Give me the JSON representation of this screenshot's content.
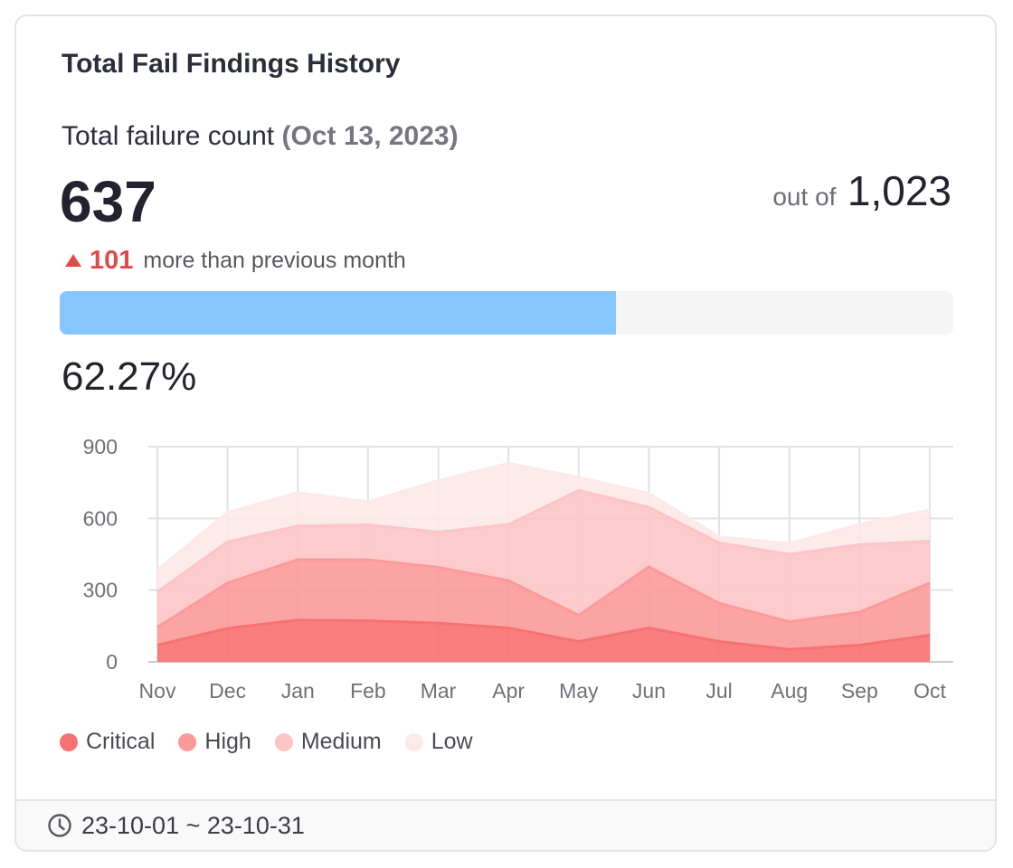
{
  "card": {
    "title": "Total Fail Findings History",
    "subtitle": "Total failure count",
    "date": "(Oct 13, 2023)",
    "count": "637",
    "out_of_label": "out of",
    "total": "1,023",
    "delta_value": "101",
    "delta_text": "more than previous month",
    "progress_fraction": 0.6227,
    "percent_text": "62.27%",
    "footer_range": "23-10-01 ~ 23-10-31"
  },
  "colors": {
    "critical": "#f87171",
    "high": "#fc9a9a",
    "medium": "#fdc5c5",
    "low": "#fde9e9",
    "accent_red": "#e24a4a",
    "progress": "#86c6fb"
  },
  "chart_data": {
    "type": "area",
    "stacked": true,
    "categories": [
      "Nov",
      "Dec",
      "Jan",
      "Feb",
      "Mar",
      "Apr",
      "May",
      "Jun",
      "Jul",
      "Aug",
      "Sep",
      "Oct"
    ],
    "ylim": [
      0,
      900
    ],
    "yticks": [
      0,
      300,
      600,
      900
    ],
    "grid": true,
    "legend_position": "bottom-left",
    "series": [
      {
        "name": "Critical",
        "color": "#f87171",
        "values": [
          70,
          140,
          175,
          172,
          162,
          142,
          85,
          142,
          85,
          52,
          70,
          112
        ]
      },
      {
        "name": "High",
        "color": "#fc9a9a",
        "values": [
          75,
          190,
          253,
          255,
          233,
          198,
          110,
          255,
          160,
          116,
          138,
          218
        ]
      },
      {
        "name": "Medium",
        "color": "#fdc5c5",
        "values": [
          148,
          172,
          140,
          146,
          148,
          235,
          522,
          250,
          253,
          282,
          282,
          175
        ]
      },
      {
        "name": "Low",
        "color": "#fde9e9",
        "values": [
          92,
          123,
          140,
          97,
          215,
          255,
          55,
          58,
          25,
          45,
          85,
          130
        ]
      }
    ]
  }
}
